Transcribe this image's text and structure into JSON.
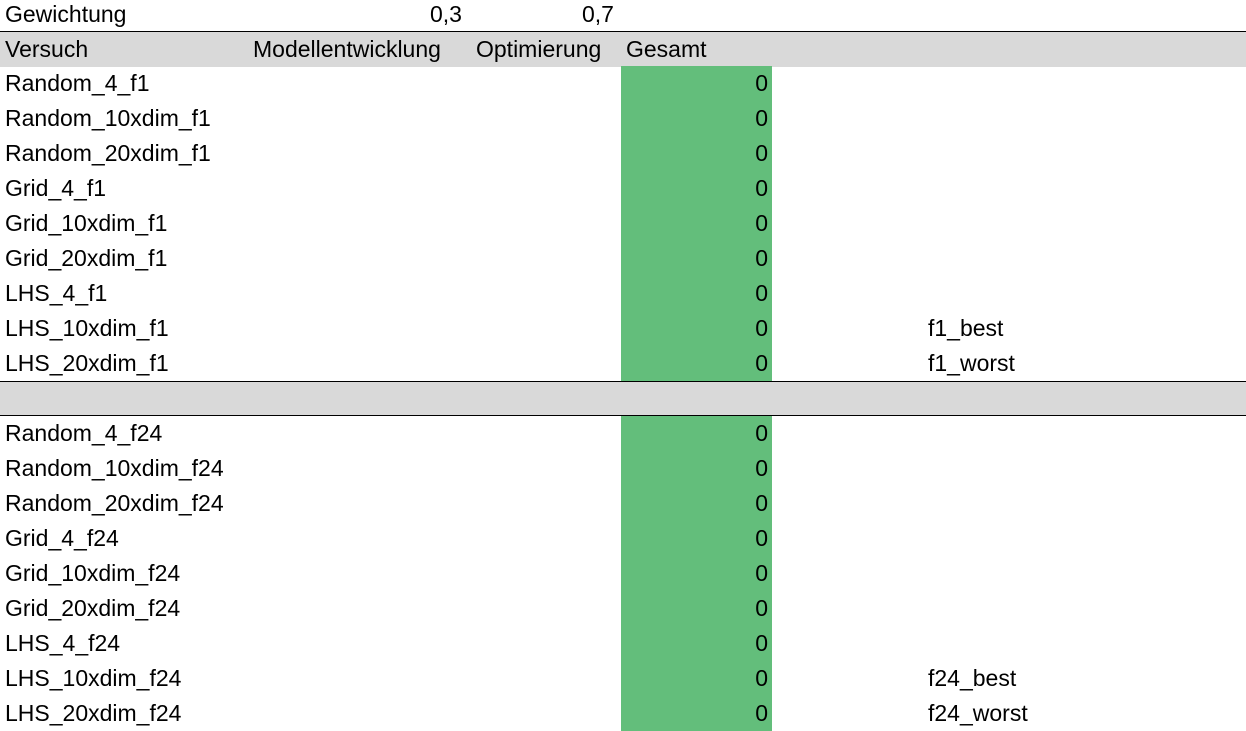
{
  "weighting_row": {
    "label": "Gewichtung",
    "weight_model": "0,3",
    "weight_opt": "0,7"
  },
  "header": {
    "col_versuch": "Versuch",
    "col_model": "Modellentwicklung",
    "col_opt": "Optimierung",
    "col_total": "Gesamt"
  },
  "group1": [
    {
      "name": "Random_4_f1",
      "total": "0",
      "note": ""
    },
    {
      "name": "Random_10xdim_f1",
      "total": "0",
      "note": ""
    },
    {
      "name": "Random_20xdim_f1",
      "total": "0",
      "note": ""
    },
    {
      "name": "Grid_4_f1",
      "total": "0",
      "note": ""
    },
    {
      "name": "Grid_10xdim_f1",
      "total": "0",
      "note": ""
    },
    {
      "name": "Grid_20xdim_f1",
      "total": "0",
      "note": ""
    },
    {
      "name": "LHS_4_f1",
      "total": "0",
      "note": ""
    },
    {
      "name": "LHS_10xdim_f1",
      "total": "0",
      "note": "f1_best"
    },
    {
      "name": "LHS_20xdim_f1",
      "total": "0",
      "note": "f1_worst"
    }
  ],
  "group2": [
    {
      "name": "Random_4_f24",
      "total": "0",
      "note": ""
    },
    {
      "name": "Random_10xdim_f24",
      "total": "0",
      "note": ""
    },
    {
      "name": "Random_20xdim_f24",
      "total": "0",
      "note": ""
    },
    {
      "name": "Grid_4_f24",
      "total": "0",
      "note": ""
    },
    {
      "name": "Grid_10xdim_f24",
      "total": "0",
      "note": ""
    },
    {
      "name": "Grid_20xdim_f24",
      "total": "0",
      "note": ""
    },
    {
      "name": "LHS_4_f24",
      "total": "0",
      "note": ""
    },
    {
      "name": "LHS_10xdim_f24",
      "total": "0",
      "note": "f24_best"
    },
    {
      "name": "LHS_20xdim_f24",
      "total": "0",
      "note": "f24_worst"
    }
  ],
  "colors": {
    "header_bg": "#d9d9d9",
    "total_fill": "#63be7b"
  }
}
